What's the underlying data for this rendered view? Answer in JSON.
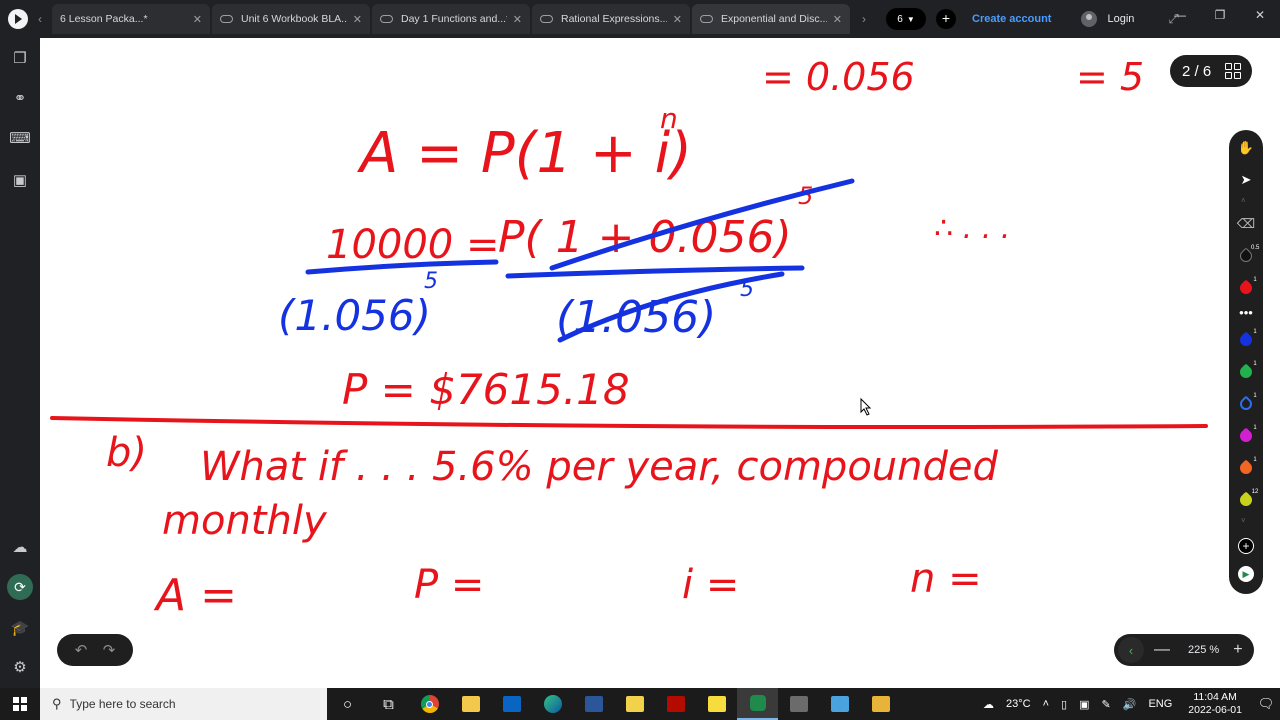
{
  "tabs": [
    {
      "label": "6 Lesson Packa...*"
    },
    {
      "label": "Unit 6 Workbook BLA...*"
    },
    {
      "label": "Day 1 Functions and...*"
    },
    {
      "label": "Rational Expressions...*"
    },
    {
      "label": "Exponential and Disc...*",
      "active": true
    }
  ],
  "header": {
    "tab_count": "6",
    "create_account": "Create account",
    "login": "Login"
  },
  "page_indicator": "2 / 6",
  "zoom": "225 %",
  "ink": {
    "top_value_1": "= 0.056",
    "top_value_2": "= 5",
    "formula": "A = P(1 + i)",
    "formula_exp": "n",
    "eq_left": "10000 =",
    "eq_right": "P( 1 + 0.056)",
    "eq_exp": "5",
    "denom_left": "(1.056)",
    "denom_exp": "5",
    "denom_right": "(1.056)",
    "therefore": "∴ . . .",
    "result": "P = $7615.18",
    "part_b_label": "b)",
    "part_b_text": "What if . . . 5.6% per year, compounded",
    "part_b_text2": "monthly",
    "var_a": "A =",
    "var_p": "P =",
    "var_i": "i =",
    "var_n": "n ="
  },
  "colors": {
    "ink_red": "#e8141b",
    "ink_blue": "#1432e0",
    "accent_link": "#4a9cff"
  },
  "taskbar": {
    "search_placeholder": "Type here to search",
    "temperature": "23°C",
    "language": "ENG",
    "time": "11:04 AM",
    "date": "2022-06-01"
  },
  "tool_badges": [
    "0.5",
    "1",
    "1",
    "1",
    "1",
    "1",
    "1",
    "12"
  ]
}
